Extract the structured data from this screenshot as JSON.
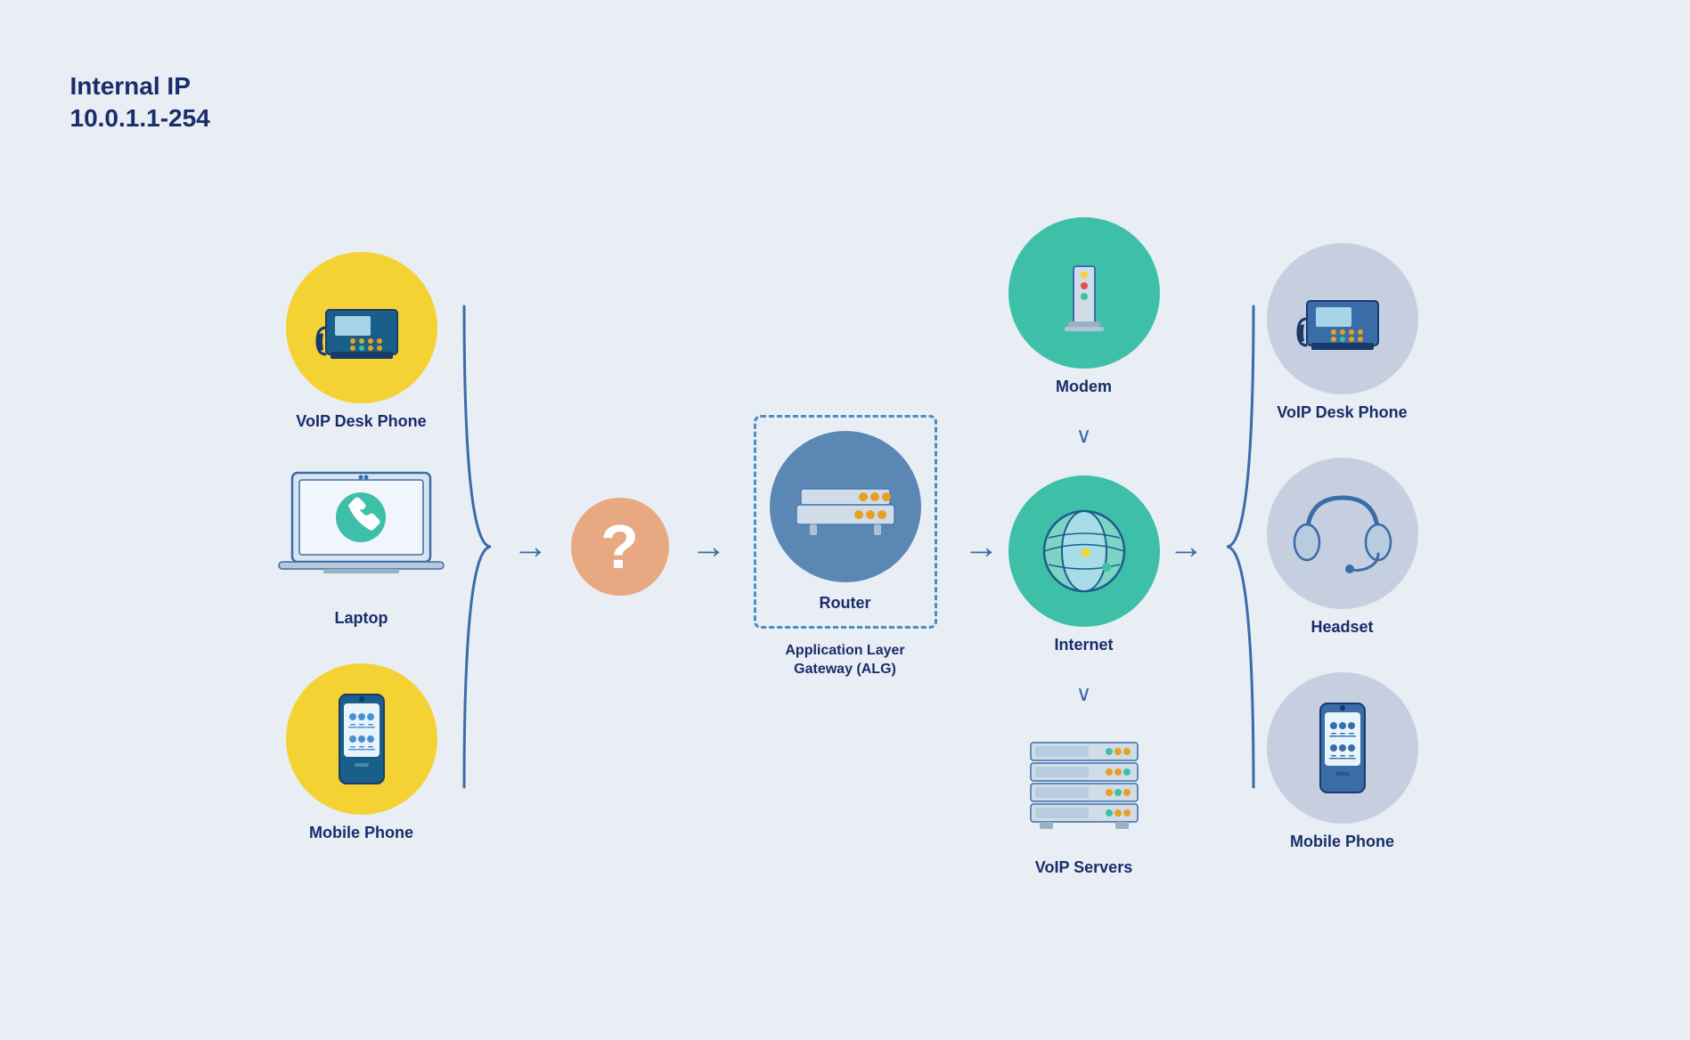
{
  "internal_ip": {
    "line1": "Internal IP",
    "line2": "10.0.1.1-254"
  },
  "left_devices": [
    {
      "id": "voip-desk-phone-left",
      "label": "VoIP Desk Phone",
      "type": "yellow"
    },
    {
      "id": "laptop",
      "label": "Laptop",
      "type": "white"
    },
    {
      "id": "mobile-phone-left",
      "label": "Mobile Phone",
      "type": "yellow"
    }
  ],
  "middle": {
    "router_label": "Router",
    "gateway_label": "Application Layer\nGateway (ALG)"
  },
  "middle_right": [
    {
      "id": "modem",
      "label": "Modem",
      "type": "teal"
    },
    {
      "id": "internet",
      "label": "Internet",
      "type": "teal"
    },
    {
      "id": "voip-servers",
      "label": "VoIP Servers",
      "type": "standalone"
    }
  ],
  "right_devices": [
    {
      "id": "voip-desk-phone-right",
      "label": "VoIP Desk Phone",
      "type": "gray"
    },
    {
      "id": "headset",
      "label": "Headset",
      "type": "gray"
    },
    {
      "id": "mobile-phone-right",
      "label": "Mobile Phone",
      "type": "gray"
    }
  ],
  "colors": {
    "yellow": "#f5d234",
    "teal": "#3dbfa8",
    "gray": "#c5cfe0",
    "blue_dark": "#1a2d6b",
    "blue_mid": "#3a6ca8",
    "router_circle": "#5b87b5"
  },
  "arrows": {
    "right": "→",
    "down": "∨"
  }
}
